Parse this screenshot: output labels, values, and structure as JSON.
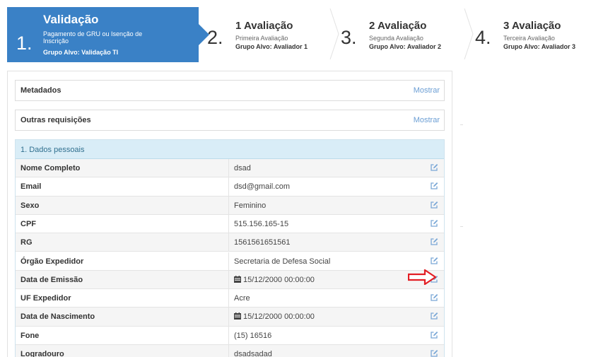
{
  "wizard": {
    "steps": [
      {
        "number": "1.",
        "title": "Validação",
        "subtitle": "Pagamento de GRU ou Isenção de Inscrição",
        "group": "Grupo Alvo: Validação TI",
        "active": true
      },
      {
        "number": "2.",
        "title": "1 Avaliação",
        "subtitle": "Primeira Avaliação",
        "group": "Grupo Alvo: Avaliador 1",
        "active": false
      },
      {
        "number": "3.",
        "title": "2 Avaliação",
        "subtitle": "Segunda Avaliação",
        "group": "Grupo Alvo: Avaliador 2",
        "active": false
      },
      {
        "number": "4.",
        "title": "3 Avaliação",
        "subtitle": "Terceira Avaliação",
        "group": "Grupo Alvo: Avaliador 3",
        "active": false
      }
    ]
  },
  "metadados": {
    "label": "Metadados",
    "action": "Mostrar"
  },
  "outras": {
    "label": "Outras requisições",
    "action": "Mostrar"
  },
  "dados": {
    "title": "1. Dados pessoais",
    "rows": [
      {
        "label": "Nome Completo",
        "value": "dsad",
        "calendar": false
      },
      {
        "label": "Email",
        "value": "dsd@gmail.com",
        "calendar": false
      },
      {
        "label": "Sexo",
        "value": "Feminino",
        "calendar": false
      },
      {
        "label": "CPF",
        "value": "515.156.165-15",
        "calendar": false
      },
      {
        "label": "RG",
        "value": "1561561651561",
        "calendar": false
      },
      {
        "label": "Órgão Expedidor",
        "value": "Secretaria de Defesa Social",
        "calendar": false
      },
      {
        "label": "Data de Emissão",
        "value": "15/12/2000 00:00:00",
        "calendar": true
      },
      {
        "label": "UF Expedidor",
        "value": "Acre",
        "calendar": false
      },
      {
        "label": "Data de Nascimento",
        "value": "15/12/2000 00:00:00",
        "calendar": true
      },
      {
        "label": "Fone",
        "value": "(15) 16516",
        "calendar": false
      },
      {
        "label": "Logradouro",
        "value": "dsadsadad",
        "calendar": false
      }
    ]
  },
  "colors": {
    "active_step": "#3a81c6",
    "link": "#6b9ed4",
    "section_header": "#d9edf7",
    "annotation_arrow": "#e31e24"
  },
  "icons": {
    "edit": "edit-icon",
    "calendar": "calendar-icon",
    "annotation": "red-arrow-annotation"
  }
}
